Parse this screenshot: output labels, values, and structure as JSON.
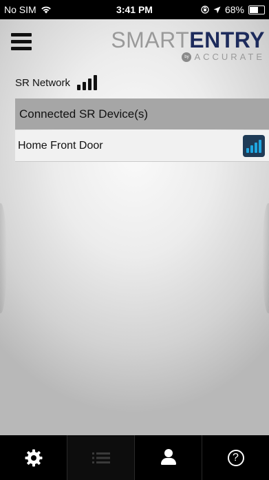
{
  "status_bar": {
    "carrier": "No SIM",
    "time": "3:41 PM",
    "battery_percent": "68%",
    "battery_level": 0.68
  },
  "header": {
    "logo_smart": "SMART",
    "logo_entry": "ENTRY",
    "logo_by": "by",
    "logo_sub": "ACCURATE"
  },
  "network": {
    "label": "SR Network",
    "signal_bars": 4
  },
  "devices": {
    "section_title": "Connected SR Device(s)",
    "items": [
      {
        "name": "Home Front Door",
        "signal_bars": 4
      }
    ]
  },
  "tab_bar": {
    "tabs": [
      {
        "name": "settings",
        "icon": "gear-icon",
        "active": false
      },
      {
        "name": "list",
        "icon": "list-icon",
        "active": true
      },
      {
        "name": "profile",
        "icon": "person-icon",
        "active": false
      },
      {
        "name": "help",
        "icon": "help-icon",
        "active": false,
        "glyph": "?"
      }
    ]
  },
  "colors": {
    "brand_navy": "#1d2b5c",
    "signal_blue": "#1fa7e1",
    "section_header_bg": "#a6a6a6"
  }
}
